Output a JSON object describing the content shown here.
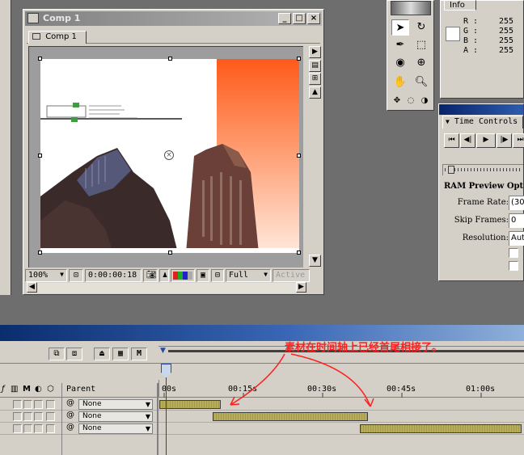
{
  "comp_window": {
    "title": "Comp 1",
    "tab_label": "Comp 1",
    "zoom": "100%",
    "timecode": "0:00:00:18",
    "resolution": "Full",
    "view_select": "Active"
  },
  "info_panel": {
    "title": "Info",
    "rows": [
      {
        "label": "R",
        "value": "255"
      },
      {
        "label": "G",
        "value": "255"
      },
      {
        "label": "B",
        "value": "255"
      },
      {
        "label": "A",
        "value": "255"
      }
    ]
  },
  "time_controls": {
    "title": "Time Controls",
    "ram_preview": "RAM Preview Opt",
    "frame_rate_label": "Frame Rate:",
    "frame_rate_value": "(30",
    "skip_frames_label": "Skip Frames:",
    "skip_frames_value": "0",
    "resolution_label": "Resolution:",
    "resolution_value": "Aut"
  },
  "timeline": {
    "parent_header": "Parent",
    "time_labels": [
      "00s",
      "00:15s",
      "00:30s",
      "00:45s",
      "01:00s"
    ],
    "layers": [
      {
        "parent": "None"
      },
      {
        "parent": "None"
      },
      {
        "parent": "None"
      }
    ]
  },
  "annotation": {
    "text": "素材在时间轴上已经首尾相接了。",
    "color": "#ff2020"
  },
  "colors": {
    "layer_bar": "#b8ae5a",
    "timeline_title": "#0a2d6e"
  }
}
